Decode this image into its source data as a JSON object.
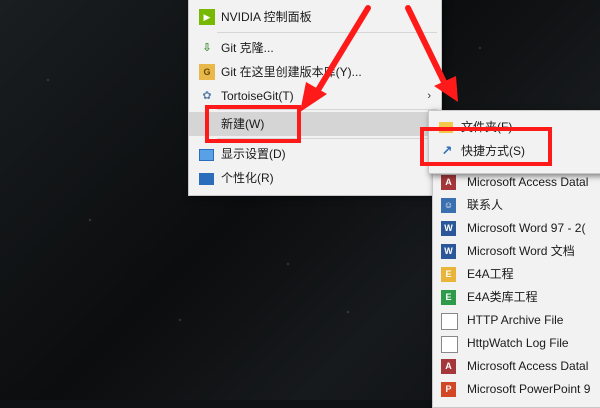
{
  "main_menu": {
    "items": [
      {
        "label": "NVIDIA 控制面板",
        "icon": "nvidia-icon"
      },
      {
        "label": "Git 克隆...",
        "icon": "git-clone-icon"
      },
      {
        "label": "Git 在这里创建版本库(Y)...",
        "icon": "git-repo-icon"
      },
      {
        "label": "TortoiseGit(T)",
        "icon": "tortoisegit-icon"
      },
      {
        "label": "新建(W)",
        "icon": ""
      },
      {
        "label": "显示设置(D)",
        "icon": "display-icon"
      },
      {
        "label": "个性化(R)",
        "icon": "personalize-icon"
      }
    ]
  },
  "new_submenu": {
    "items": [
      {
        "label": "文件夹(F)",
        "icon": "folder-icon"
      },
      {
        "label": "快捷方式(S)",
        "icon": "shortcut-icon"
      }
    ]
  },
  "file_types": {
    "items": [
      {
        "label": "Microsoft Access Datal",
        "icon": "access-icon",
        "color": "#a4373a",
        "glyph": "A"
      },
      {
        "label": "联系人",
        "icon": "contact-icon",
        "color": "#3a6fb0",
        "glyph": "☺"
      },
      {
        "label": "Microsoft Word 97 - 2(",
        "icon": "word-icon",
        "color": "#2b579a",
        "glyph": "W"
      },
      {
        "label": "Microsoft Word 文档",
        "icon": "word-icon",
        "color": "#2b579a",
        "glyph": "W"
      },
      {
        "label": "E4A工程",
        "icon": "e4a-icon",
        "color": "#e9b43a",
        "glyph": "E"
      },
      {
        "label": "E4A类库工程",
        "icon": "e4a-lib-icon",
        "color": "#2e9b4a",
        "glyph": "E"
      },
      {
        "label": "HTTP Archive File",
        "icon": "file-icon",
        "color": "#ffffff",
        "glyph": ""
      },
      {
        "label": "HttpWatch Log File",
        "icon": "file-icon",
        "color": "#ffffff",
        "glyph": ""
      },
      {
        "label": "Microsoft Access Datal",
        "icon": "access-icon",
        "color": "#a4373a",
        "glyph": "A"
      },
      {
        "label": "Microsoft PowerPoint 9",
        "icon": "powerpoint-icon",
        "color": "#d24726",
        "glyph": "P"
      }
    ]
  },
  "colors": {
    "highlight": "#ff1a1a",
    "menu_bg": "#f2f2f2"
  }
}
